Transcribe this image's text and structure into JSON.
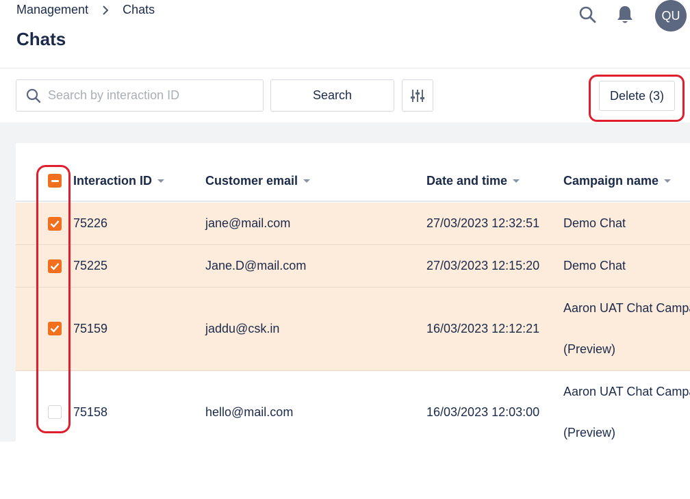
{
  "breadcrumb": {
    "parent": "Management",
    "current": "Chats"
  },
  "page": {
    "title": "Chats"
  },
  "user": {
    "initials": "QU"
  },
  "toolbar": {
    "search_placeholder": "Search by interaction ID",
    "search_value": "",
    "search_label": "Search",
    "delete_label": "Delete (3)"
  },
  "table": {
    "columns": [
      "Interaction ID",
      "Customer email",
      "Date and time",
      "Campaign name"
    ],
    "select_all_state": "indeterminate",
    "rows": [
      {
        "selected": true,
        "id": "75226",
        "email": "jane@mail.com",
        "datetime": "27/03/2023 12:32:51",
        "campaign": "Demo Chat",
        "campaign_sub": ""
      },
      {
        "selected": true,
        "id": "75225",
        "email": "Jane.D@mail.com",
        "datetime": "27/03/2023 12:15:20",
        "campaign": "Demo Chat",
        "campaign_sub": ""
      },
      {
        "selected": true,
        "id": "75159",
        "email": "jaddu@csk.in",
        "datetime": "16/03/2023 12:12:21",
        "campaign": "Aaron UAT Chat Campa",
        "campaign_sub": "(Preview)"
      },
      {
        "selected": false,
        "id": "75158",
        "email": "hello@mail.com",
        "datetime": "16/03/2023 12:03:00",
        "campaign": "Aaron UAT Chat Campa",
        "campaign_sub": "(Preview)"
      }
    ]
  },
  "colors": {
    "accent": "#f26f1e",
    "selected_row": "#fdebdb",
    "highlight": "#e01e2d",
    "title": "#1b2a4a"
  },
  "icons": [
    "chevron-right-icon",
    "search-icon",
    "bell-icon",
    "filter-sliders-icon"
  ]
}
